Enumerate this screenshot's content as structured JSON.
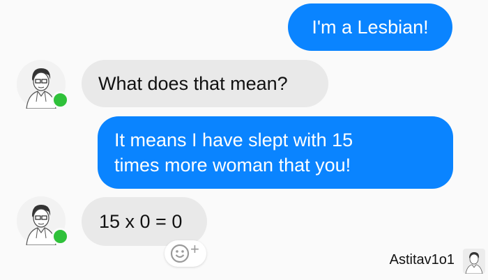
{
  "messages": [
    {
      "side": "sent",
      "text": "I'm a Lesbian!"
    },
    {
      "side": "received",
      "text": "What does that mean?"
    },
    {
      "side": "sent",
      "line1": "It means I have slept with 15",
      "line2": "times more woman that you!"
    },
    {
      "side": "received",
      "text": "15 x 0 = 0"
    }
  ],
  "reaction": {
    "icon": "smiley-add-reaction-icon",
    "plus": "+"
  },
  "watermark": {
    "username": "Astitav1o1"
  },
  "colors": {
    "sent_bubble": "#0a84ff",
    "received_bubble": "#e9e9e9",
    "online_dot": "#2fc13a",
    "background": "#fafafa"
  },
  "icons": {
    "avatar": "user-avatar",
    "online": "online-status-dot"
  }
}
